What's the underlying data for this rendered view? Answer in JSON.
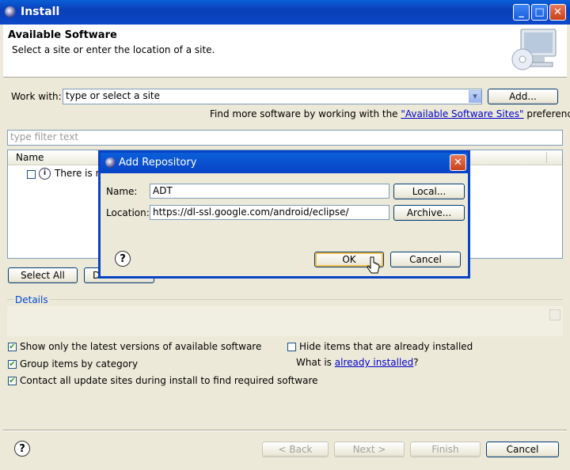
{
  "window": {
    "title": "Install",
    "minimize_glyph": "_",
    "maximize_glyph": "□",
    "close_glyph": "✕"
  },
  "header": {
    "title": "Available Software",
    "subtitle": "Select a site or enter the location of a site."
  },
  "work_with": {
    "label": "Work with:",
    "value": "type or select a site",
    "add_button": "Add...",
    "hint_prefix": "Find more software by working with the ",
    "hint_link": "\"Available Software Sites\"",
    "hint_suffix": " preferences."
  },
  "filter": {
    "placeholder": "type filter text"
  },
  "table": {
    "column_name": "Name",
    "row_text": "There is n"
  },
  "buttons": {
    "select_all": "Select All",
    "deselect_all": "D"
  },
  "details": {
    "label": "Details"
  },
  "options": {
    "show_latest": "Show only the latest versions of available software",
    "group_by_category": "Group items by category",
    "contact_sites": "Contact all update sites during install to find required software",
    "hide_installed": "Hide items that are already installed",
    "what_is_prefix": "What is ",
    "what_is_link": "already installed",
    "what_is_suffix": "?"
  },
  "footer": {
    "back": "< Back",
    "next": "Next >",
    "finish": "Finish",
    "cancel": "Cancel"
  },
  "dialog": {
    "title": "Add Repository",
    "name_label": "Name:",
    "name_value": "ADT",
    "location_label": "Location:",
    "location_value": "https://dl-ssl.google.com/android/eclipse/",
    "local_button": "Local...",
    "archive_button": "Archive...",
    "ok_button": "OK",
    "cancel_button": "Cancel"
  },
  "icons": {
    "help": "?",
    "info": "i",
    "dropdown": "▾",
    "check": "✔"
  }
}
